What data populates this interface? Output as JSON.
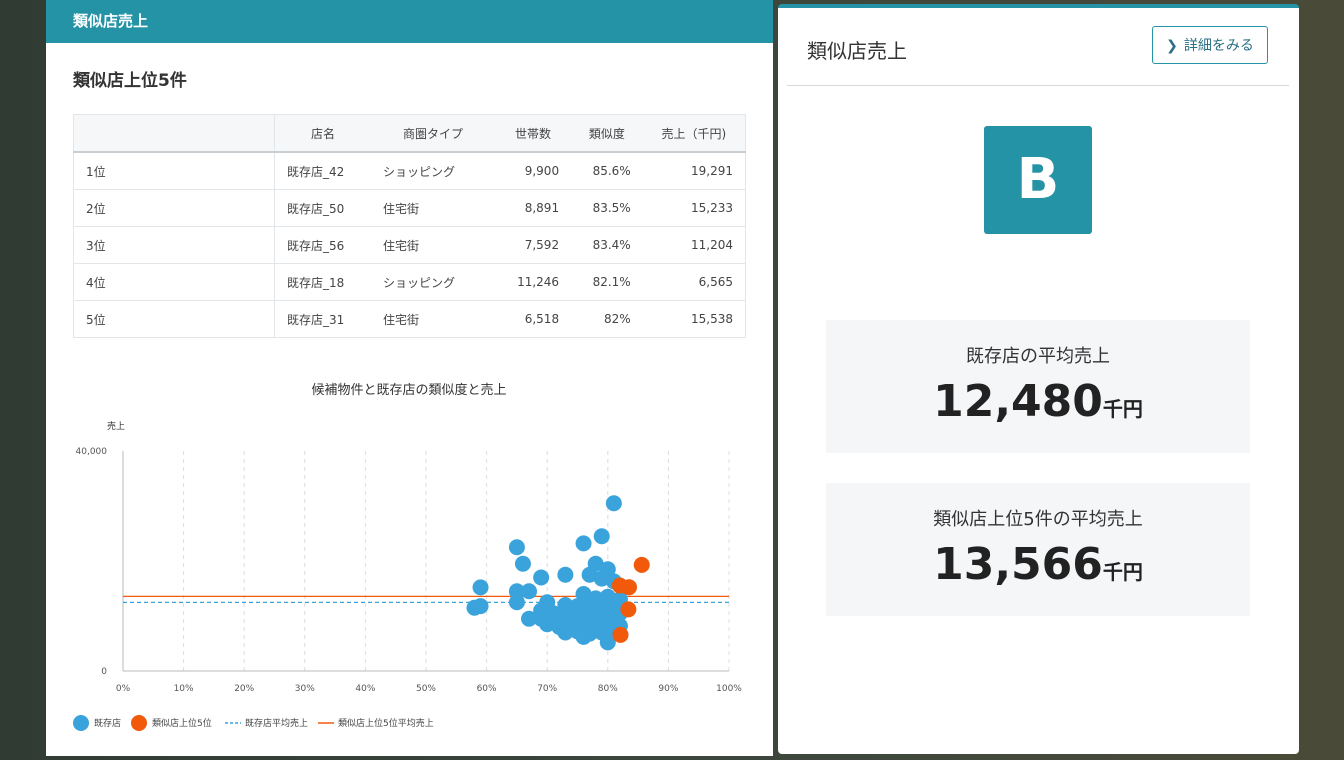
{
  "left": {
    "header": "類似店売上",
    "section_title": "類似店上位5件",
    "table": {
      "columns": [
        "",
        "店名",
        "商圏タイプ",
        "世帯数",
        "類似度",
        "売上（千円)"
      ],
      "rows": [
        [
          "1位",
          "既存店_42",
          "ショッピング",
          "9,900",
          "85.6%",
          "19,291"
        ],
        [
          "2位",
          "既存店_50",
          "住宅街",
          "8,891",
          "83.5%",
          "15,233"
        ],
        [
          "3位",
          "既存店_56",
          "住宅街",
          "7,592",
          "83.4%",
          "11,204"
        ],
        [
          "4位",
          "既存店_18",
          "ショッピング",
          "11,246",
          "82.1%",
          "6,565"
        ],
        [
          "5位",
          "既存店_31",
          "住宅街",
          "6,518",
          "82%",
          "15,538"
        ]
      ]
    }
  },
  "right": {
    "title": "類似店売上",
    "detail_button": "詳細をみる",
    "grade": "B",
    "avg_existing": {
      "label": "既存店の平均売上",
      "value": "12,480",
      "unit": "千円"
    },
    "avg_top5": {
      "label": "類似店上位5件の平均売上",
      "value": "13,566",
      "unit": "千円"
    }
  },
  "colors": {
    "accent": "#2493a6",
    "existing": "#3aa3dc",
    "top5": "#f05a0a"
  },
  "chart_data": {
    "type": "scatter",
    "title": "候補物件と既存店の類似度と売上",
    "ylabel": "売上",
    "xlabel": "",
    "xlim": [
      0,
      100
    ],
    "ylim": [
      0,
      40000
    ],
    "x_ticks": [
      "0%",
      "10%",
      "20%",
      "30%",
      "40%",
      "50%",
      "60%",
      "70%",
      "80%",
      "90%",
      "100%"
    ],
    "y_ticks": [
      "0",
      "40,000"
    ],
    "grid": "vertical dashed",
    "legend_position": "bottom-left",
    "series": [
      {
        "name": "既存店",
        "color": "#3aa3dc",
        "points": [
          [
            81,
            30500
          ],
          [
            79,
            24500
          ],
          [
            76,
            23200
          ],
          [
            65,
            22500
          ],
          [
            66,
            19500
          ],
          [
            78,
            19500
          ],
          [
            80,
            18500
          ],
          [
            77,
            17500
          ],
          [
            73,
            17500
          ],
          [
            69,
            17000
          ],
          [
            79,
            16800
          ],
          [
            81,
            16300
          ],
          [
            59,
            15200
          ],
          [
            65,
            14500
          ],
          [
            67,
            14500
          ],
          [
            76,
            14000
          ],
          [
            78,
            13200
          ],
          [
            80,
            13500
          ],
          [
            82,
            13000
          ],
          [
            70,
            12500
          ],
          [
            65,
            12500
          ],
          [
            73,
            12000
          ],
          [
            75,
            11800
          ],
          [
            77,
            12500
          ],
          [
            79,
            12200
          ],
          [
            81,
            11500
          ],
          [
            59,
            11800
          ],
          [
            58,
            11500
          ],
          [
            69,
            11000
          ],
          [
            71,
            10500
          ],
          [
            72,
            10200
          ],
          [
            74,
            10500
          ],
          [
            76,
            10800
          ],
          [
            78,
            10500
          ],
          [
            80,
            10200
          ],
          [
            82,
            10500
          ],
          [
            67,
            9500
          ],
          [
            69,
            9500
          ],
          [
            71,
            9000
          ],
          [
            73,
            9300
          ],
          [
            75,
            9600
          ],
          [
            77,
            9200
          ],
          [
            79,
            9500
          ],
          [
            81,
            9000
          ],
          [
            70,
            8500
          ],
          [
            72,
            8000
          ],
          [
            74,
            8300
          ],
          [
            76,
            7800
          ],
          [
            78,
            8000
          ],
          [
            80,
            7500
          ],
          [
            82,
            8200
          ],
          [
            73,
            7000
          ],
          [
            75,
            7200
          ],
          [
            77,
            6800
          ],
          [
            79,
            7000
          ],
          [
            76,
            6200
          ],
          [
            80,
            5200
          ]
        ]
      },
      {
        "name": "類似店上位5位",
        "color": "#f05a0a",
        "points": [
          [
            85.6,
            19291
          ],
          [
            83.5,
            15233
          ],
          [
            83.4,
            11204
          ],
          [
            82.1,
            6565
          ],
          [
            82,
            15538
          ]
        ]
      }
    ],
    "reference_lines": [
      {
        "name": "既存店平均売上",
        "value": 12480,
        "style": "dashed",
        "color": "#3aa3dc"
      },
      {
        "name": "類似店上位5位平均売上",
        "value": 13566,
        "style": "solid",
        "color": "#f05a0a"
      }
    ]
  }
}
